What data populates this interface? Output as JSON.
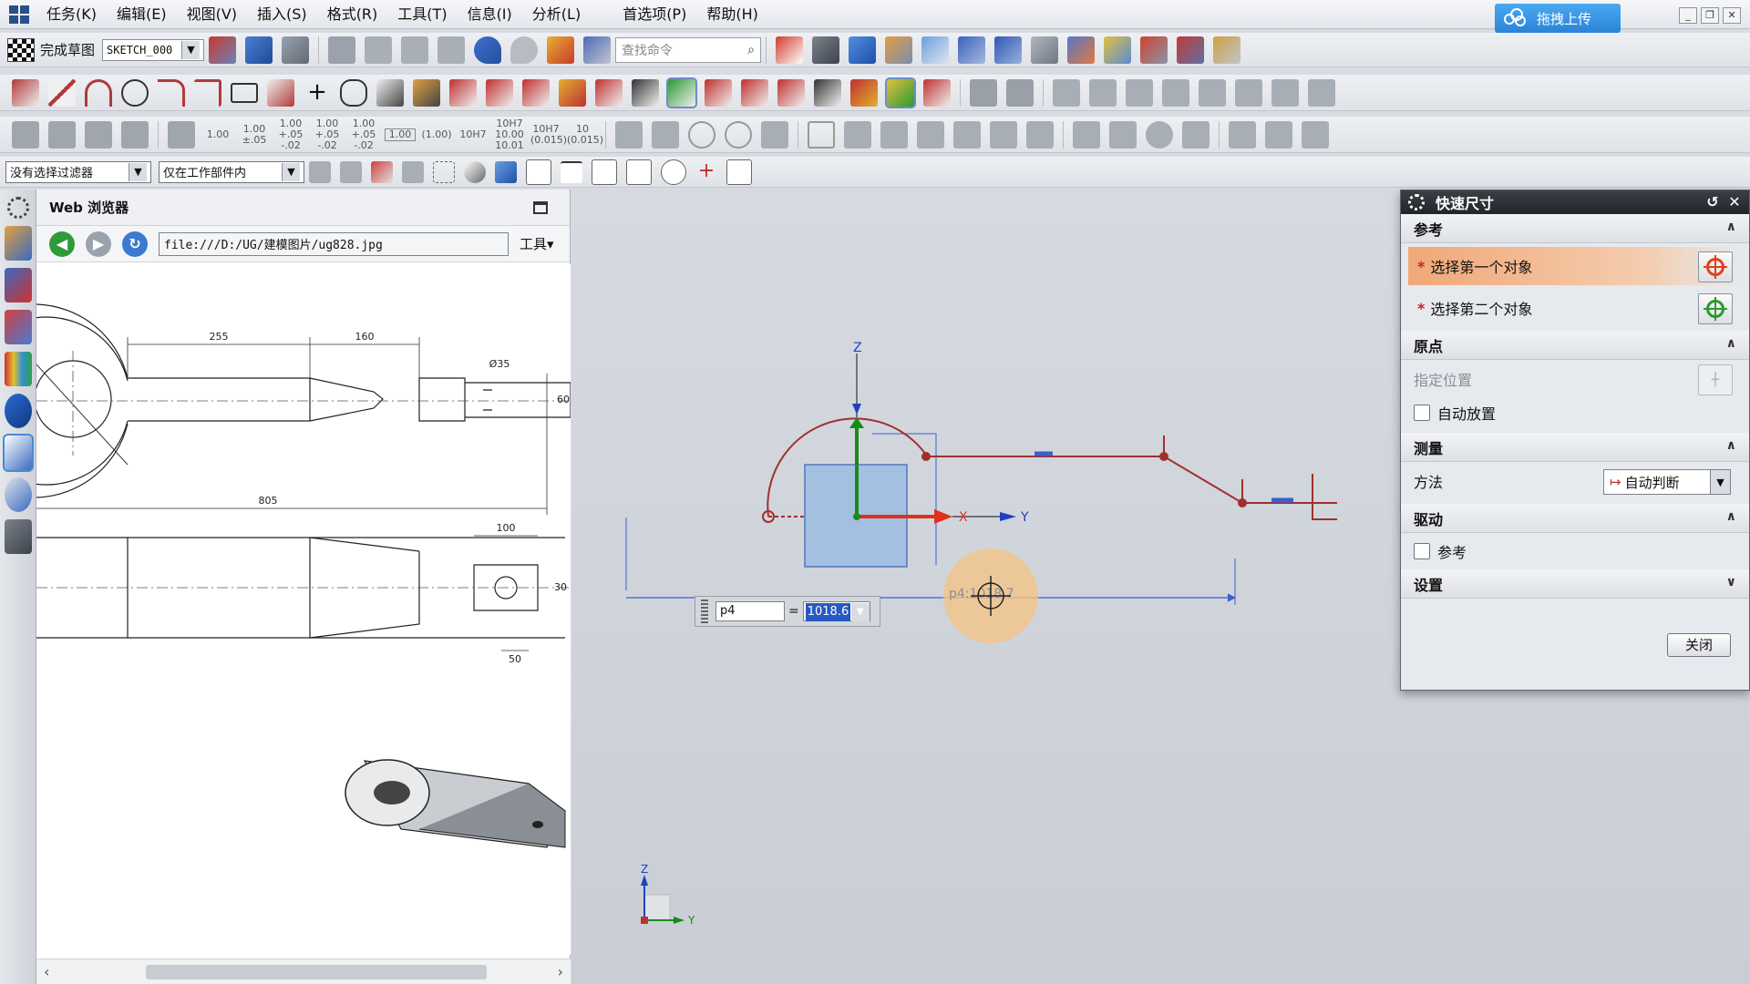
{
  "menu": {
    "items": [
      "任务(K)",
      "编辑(E)",
      "视图(V)",
      "插入(S)",
      "格式(R)",
      "工具(T)",
      "信息(I)",
      "分析(L)",
      "首选项(P)",
      "帮助(H)"
    ],
    "upload_label": "拖拽上传"
  },
  "toolbar1": {
    "finish_sketch_label": "完成草图",
    "sketch_name": "SKETCH_000",
    "search_placeholder": "查找命令"
  },
  "toolbar3": {
    "dims": [
      "1.00",
      "1.00 ±.05",
      "1.00 +.05 -.02",
      "1.00 +.05 -.02",
      "1.00 +.05 -.02",
      "1.00",
      "(1.00)",
      "10H7",
      "10H7 10.00 10.01",
      "10H7 (0.015)",
      "10 (0.015)"
    ]
  },
  "selection_bar": {
    "filter_label": "没有选择过滤器",
    "scope_label": "仅在工作部件内"
  },
  "browser": {
    "title": "Web 浏览器",
    "url": "file:///D:/UG/建模图片/ug828.jpg",
    "tools_label": "工具",
    "drawing": {
      "dim_255": "255",
      "dim_160": "160",
      "dim_dia35": "Ø35",
      "dim_60": "60",
      "dim_805": "805",
      "dim_100": "100",
      "dim_30": "30",
      "dim_50": "50"
    }
  },
  "graphics": {
    "axis_z": "Z",
    "axis_x": "X",
    "axis_y": "Y",
    "triad_z": "Z",
    "triad_y": "Y",
    "cursor_label": "p4:1018.7"
  },
  "osi": {
    "name": "p4",
    "eq": "=",
    "value": "1018.6"
  },
  "dialog": {
    "title": "快速尺寸",
    "sections": {
      "reference": "参考",
      "origin": "原点",
      "measure": "测量",
      "driving": "驱动",
      "settings": "设置"
    },
    "select_first": "选择第一个对象",
    "select_second": "选择第二个对象",
    "specify_location": "指定位置",
    "auto_place": "自动放置",
    "method_label": "方法",
    "method_value": "自动判断",
    "reference_check": "参考",
    "close_label": "关闭"
  },
  "colors": {
    "sketch_curve": "#a0302e",
    "x_axis": "#e0301e",
    "y_axis": "#2040c0",
    "z_axis": "#1a8a1a",
    "dim_line": "#3a5fd0",
    "dialog_highlight": "#f0b488"
  }
}
